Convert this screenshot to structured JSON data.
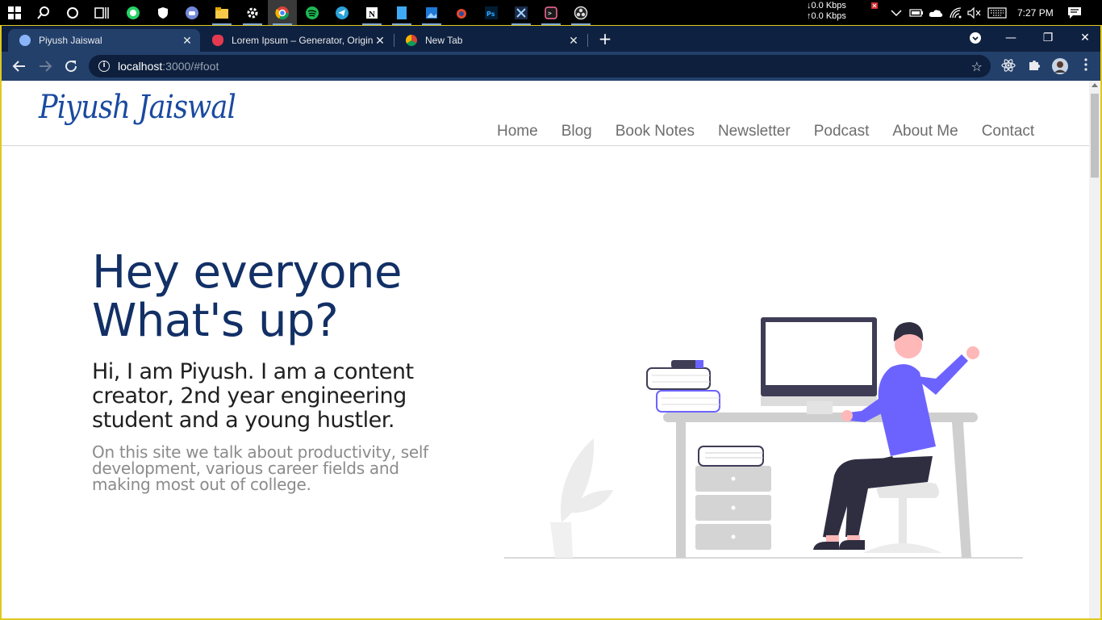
{
  "taskbar": {
    "apps": [
      "start-icon",
      "search-icon",
      "cortana-icon",
      "task-view-icon",
      "whatsapp-icon",
      "shield-icon",
      "discord-icon",
      "file-explorer-icon",
      "settings-icon",
      "chrome-icon",
      "spotify-icon",
      "telegram-icon",
      "notion-icon",
      "notepad-icon",
      "photos-icon",
      "app-icon",
      "photoshop-icon",
      "cinema-icon",
      "terminal-icon",
      "obs-icon"
    ],
    "net_down": "↓0.0 Kbps",
    "net_up": "↑0.0 Kbps",
    "time": "7:27 PM"
  },
  "browser": {
    "tabs": [
      {
        "title": "Piyush Jaiswal",
        "active": true
      },
      {
        "title": "Lorem Ipsum – Generator, Origin",
        "active": false
      },
      {
        "title": "New Tab",
        "active": false
      }
    ],
    "url_host": "localhost",
    "url_rest": ":3000/#foot"
  },
  "site": {
    "logo": "Piyush Jaiswal",
    "nav": [
      "Home",
      "Blog",
      "Book Notes",
      "Newsletter",
      "Podcast",
      "About Me",
      "Contact"
    ],
    "hero_line1": "Hey everyone",
    "hero_line2": "What's up?",
    "hero_sub": "Hi, I am Piyush. I am a content creator, 2nd year engineering student and a young hustler.",
    "hero_desc": "On this site we talk about productivity, self development, various career fields and making most out of college."
  },
  "colors": {
    "accent": "#6c63ff",
    "title": "#123066",
    "logo": "#1a4aa0",
    "frame": "#e0c91f"
  }
}
